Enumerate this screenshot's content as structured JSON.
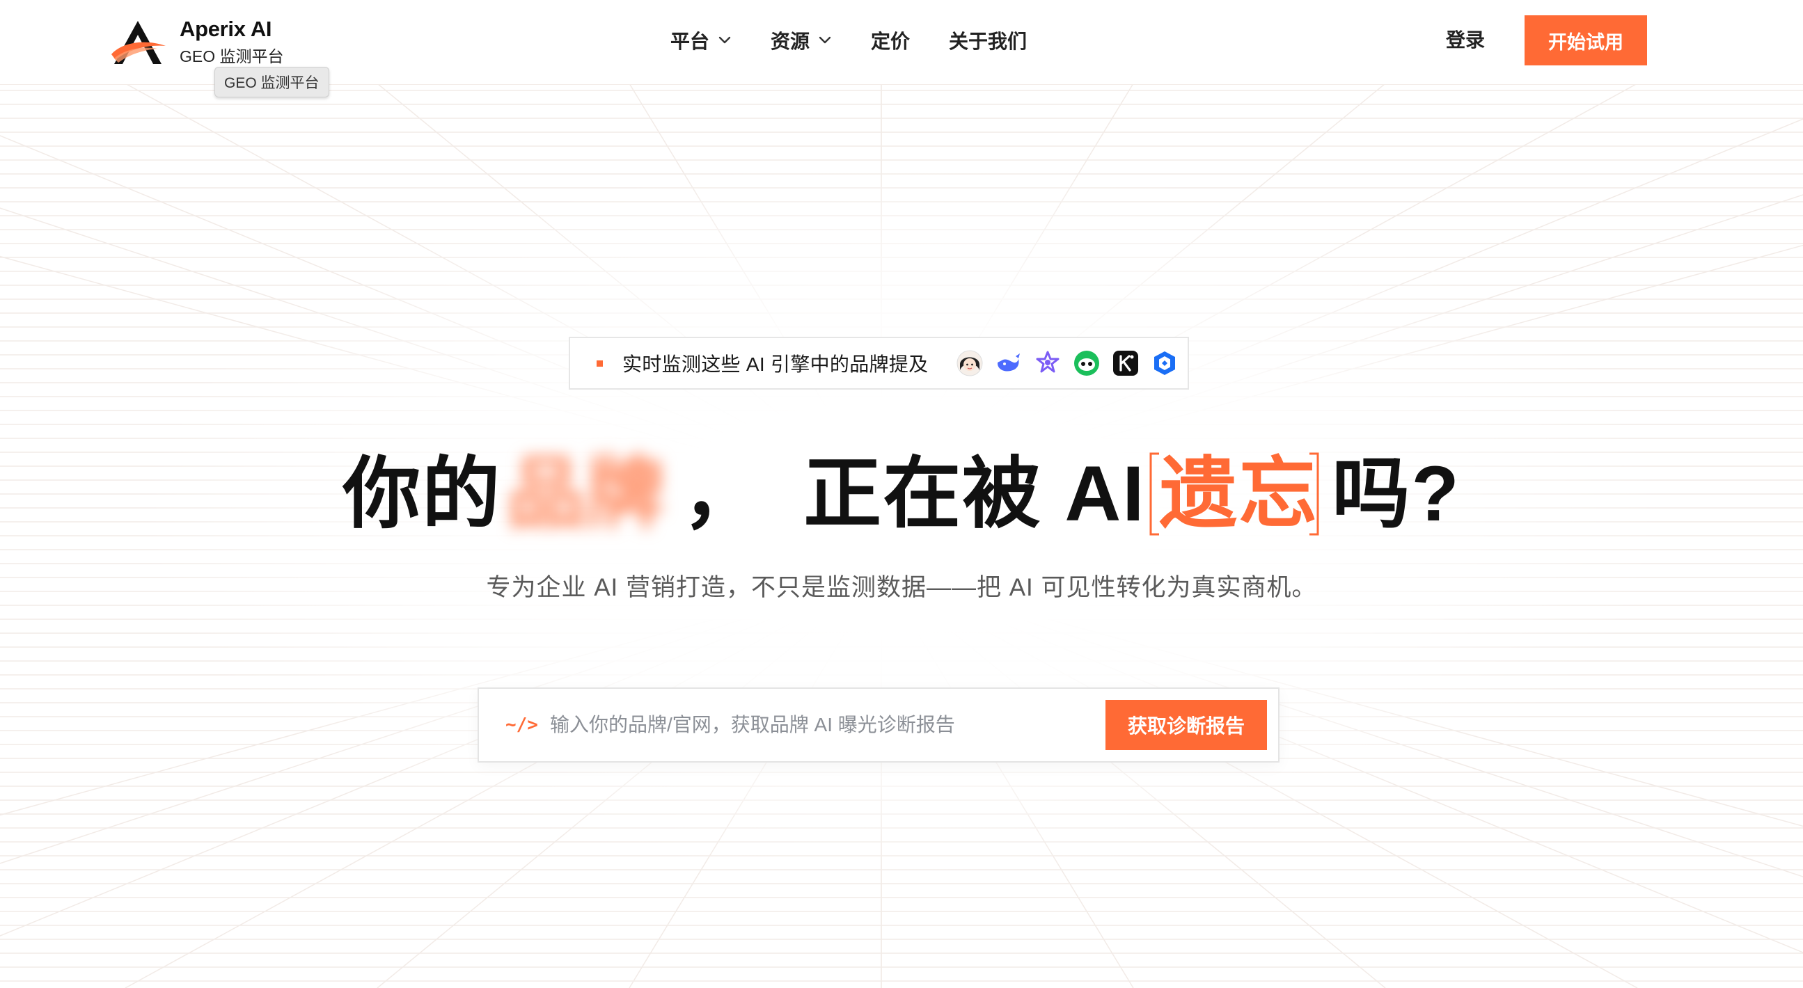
{
  "colors": {
    "accent": "#ff6a35",
    "text": "#111111",
    "muted": "#5a5a5a",
    "placeholder": "#8b8f96"
  },
  "header": {
    "brand_name": "Aperix AI",
    "brand_sub": "GEO 监测平台",
    "tooltip": "GEO 监测平台",
    "nav": [
      {
        "label": "平台",
        "dropdown": true
      },
      {
        "label": "资源",
        "dropdown": true
      },
      {
        "label": "定价",
        "dropdown": false
      },
      {
        "label": "关于我们",
        "dropdown": false
      }
    ],
    "login": "登录",
    "cta": "开始试用"
  },
  "hero": {
    "engines_label": "实时监测这些 AI 引擎中的品牌提及",
    "engine_icons": [
      "avatar-engine-icon",
      "deepseek-whale-icon",
      "purple-star-engine-icon",
      "green-engine-icon",
      "kimi-k-icon",
      "blue-cube-engine-icon"
    ],
    "headline": {
      "part1": "你的",
      "blurred": "品牌",
      "comma": "，",
      "part2": "正在被 AI",
      "highlight": "遗忘",
      "part3": "吗?"
    },
    "subline": "专为企业 AI 营销打造，不只是监测数据——把 AI 可见性转化为真实商机。",
    "search": {
      "icon_text": "~/>",
      "placeholder": "输入你的品牌/官网，获取品牌 AI 曝光诊断报告",
      "value": "",
      "button": "获取诊断报告"
    }
  }
}
